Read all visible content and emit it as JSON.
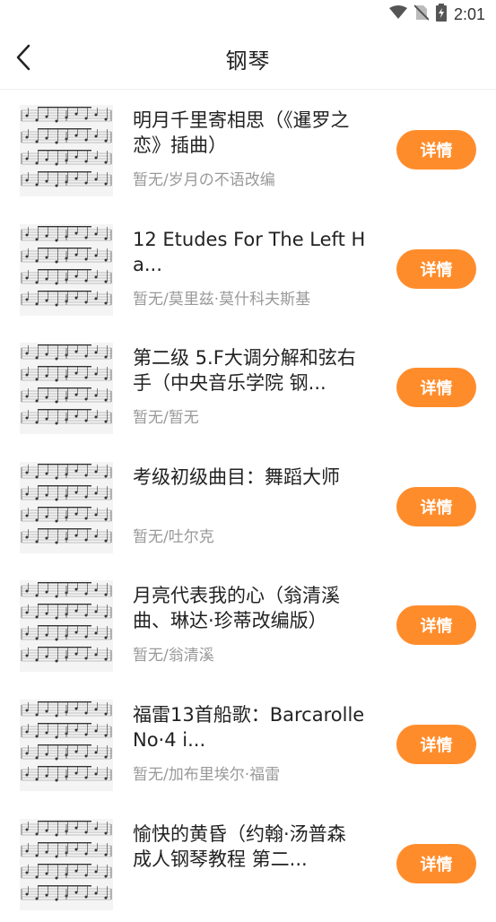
{
  "status_bar": {
    "time": "2:01",
    "icons": [
      "wifi-icon",
      "no-sim-icon",
      "battery-icon"
    ]
  },
  "header": {
    "title": "钢琴",
    "back_icon": "chevron-left-icon"
  },
  "colors": {
    "accent": "#ff8c2b",
    "title_text": "#222222",
    "subtitle_text": "#999999"
  },
  "items": [
    {
      "title": "明月千里寄相思（《暹罗之恋》插曲）",
      "subtitle": "暂无/岁月の不语改编",
      "button": "详情"
    },
    {
      "title": "12 Etudes For The Left Ha...",
      "subtitle": "暂无/莫里兹·莫什科夫斯基",
      "button": "详情"
    },
    {
      "title": "第二级 5.F大调分解和弦右手（中央音乐学院 钢...",
      "subtitle": "暂无/暂无",
      "button": "详情"
    },
    {
      "title": "考级初级曲目：舞蹈大师",
      "subtitle": "暂无/吐尔克",
      "button": "详情"
    },
    {
      "title": "月亮代表我的心（翁清溪曲、琳达·珍蒂改编版）",
      "subtitle": "暂无/翁清溪",
      "button": "详情"
    },
    {
      "title": "福雷13首船歌：Barcarolle No·4 i...",
      "subtitle": "暂无/加布里埃尔·福雷",
      "button": "详情"
    },
    {
      "title": "愉快的黄昏（约翰·汤普森 成人钢琴教程 第二...",
      "subtitle": "",
      "button": "详情"
    }
  ]
}
